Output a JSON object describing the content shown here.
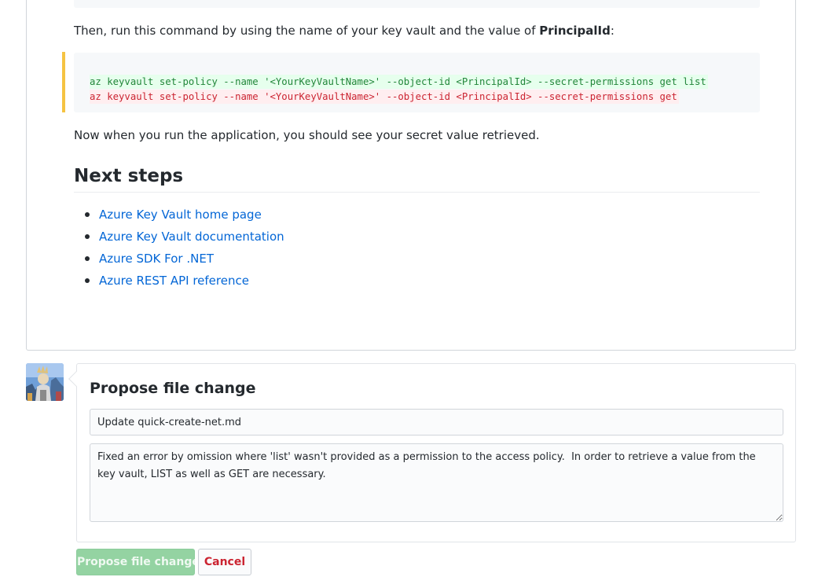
{
  "content": {
    "instruction": {
      "before": "Then, run this command by using the name of your key vault and the value of ",
      "bold": "PrincipalId",
      "after": ":"
    },
    "diff": {
      "added": "az keyvault set-policy --name '<YourKeyVaultName>' --object-id <PrincipalId> --secret-permissions get list",
      "removed": "az keyvault set-policy --name '<YourKeyVaultName>' --object-id <PrincipalId> --secret-permissions get"
    },
    "result_text": "Now when you run the application, you should see your secret value retrieved.",
    "next_steps": {
      "heading": "Next steps",
      "links": [
        {
          "label": "Azure Key Vault home page"
        },
        {
          "label": "Azure Key Vault documentation"
        },
        {
          "label": "Azure SDK For .NET"
        },
        {
          "label": "Azure REST API reference"
        }
      ]
    }
  },
  "commit_form": {
    "title": "Propose file change",
    "summary_value": "Update quick-create-net.md",
    "description_value": "Fixed an error by omission where 'list' wasn't provided as a permission to the access policy.  In order to retrieve a value from the key vault, LIST as well as GET are necessary.",
    "submit_label": "Propose file change",
    "cancel_label": "Cancel"
  },
  "colors": {
    "link": "#0366d6",
    "diff_added_bg": "#e6ffed",
    "diff_removed_bg": "#ffeef0",
    "change_marker": "#f5c342",
    "primary_button": "#94d3a2",
    "cancel_text": "#cb2431"
  },
  "icons": {
    "avatar": "user-avatar-image"
  }
}
